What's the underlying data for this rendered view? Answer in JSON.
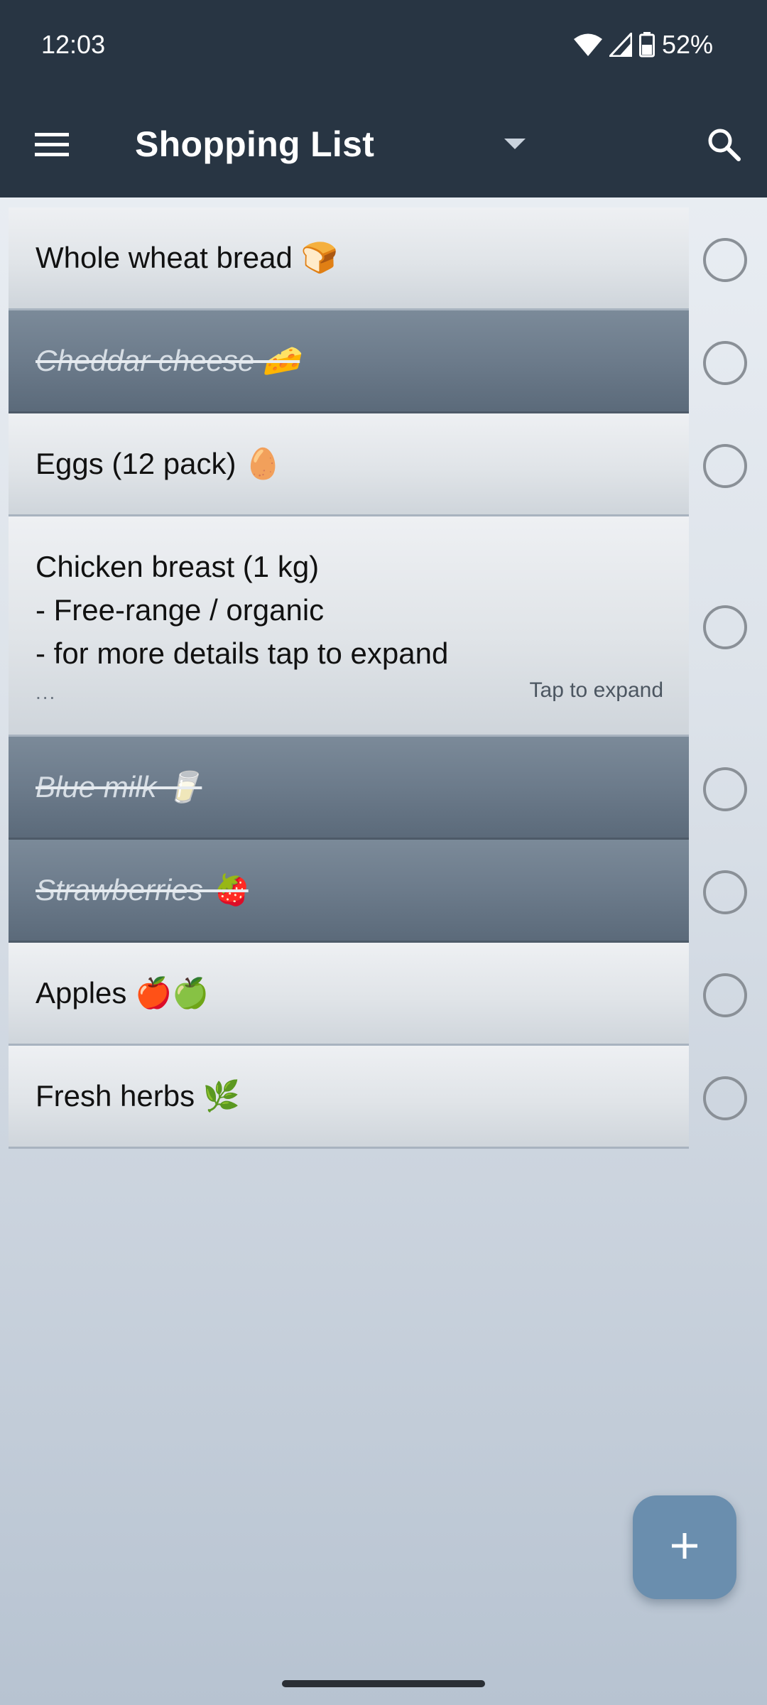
{
  "status_bar": {
    "time": "12:03",
    "battery": "52%",
    "icons": [
      "wifi-icon",
      "cell-signal-icon",
      "battery-icon"
    ]
  },
  "app_bar": {
    "title": "Shopping List",
    "menu_icon": "hamburger-menu-icon",
    "dropdown_icon": "dropdown-arrow-icon",
    "search_icon": "search-icon"
  },
  "items": [
    {
      "text": "Whole wheat bread 🍞",
      "done": false
    },
    {
      "text": "Cheddar cheese 🧀",
      "done": true
    },
    {
      "text": "Eggs (12 pack) 🥚",
      "done": false
    },
    {
      "line1": "Chicken breast (1 kg)",
      "line2": "- Free-range / organic",
      "line3": "- for more details tap to expand",
      "ellipsis": "...",
      "expand_hint": "Tap to expand",
      "done": false
    },
    {
      "text": "Blue milk 🥛",
      "done": true
    },
    {
      "text": "Strawberries 🍓",
      "done": true
    },
    {
      "text": "Apples 🍎🍏",
      "done": false
    },
    {
      "text": "Fresh herbs 🌿",
      "done": false
    }
  ],
  "fab": {
    "label": "+",
    "icon": "add-icon"
  },
  "colors": {
    "header": "#283543",
    "fab": "#6a8eae",
    "done_item": "#6c7b8b",
    "normal_item": "#e0e4e8"
  }
}
